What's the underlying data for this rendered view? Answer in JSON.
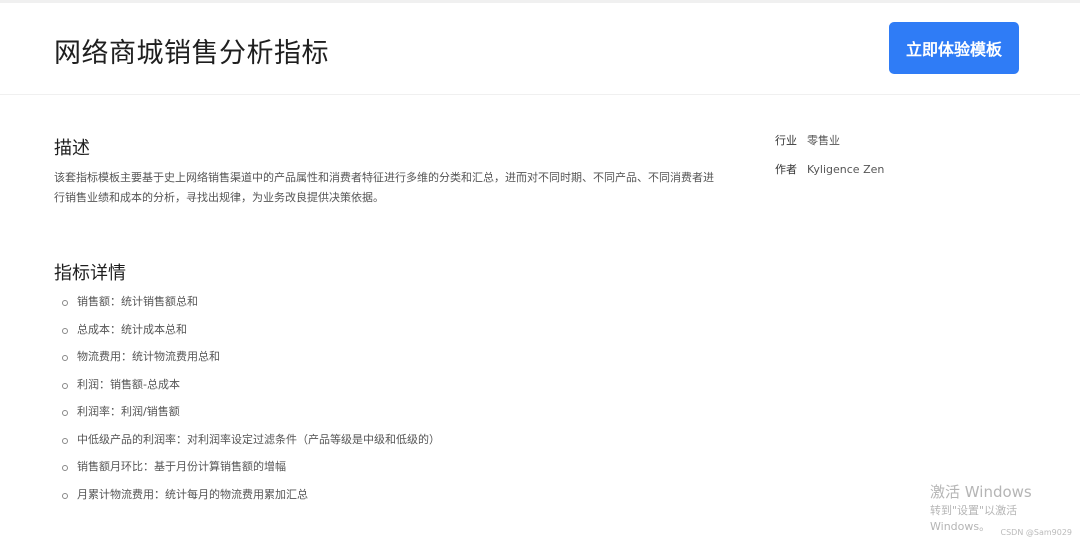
{
  "header": {
    "title": "网络商城销售分析指标",
    "cta_label": "立即体验模板"
  },
  "description": {
    "title": "描述",
    "text": "该套指标模板主要基于史上网络销售渠道中的产品属性和消费者特征进行多维的分类和汇总，进而对不同时期、不同产品、不同消费者进行销售业绩和成本的分析，寻找出规律，为业务改良提供决策依据。"
  },
  "metrics": {
    "title": "指标详情",
    "items": [
      "销售额：统计销售额总和",
      "总成本：统计成本总和",
      "物流费用：统计物流费用总和",
      "利润：销售额-总成本",
      "利润率：利润/销售额",
      "中低级产品的利润率：对利润率设定过滤条件（产品等级是中级和低级的）",
      "销售额月环比：基于月份计算销售额的增幅",
      "月累计物流费用：统计每月的物流费用累加汇总"
    ]
  },
  "meta": {
    "industry_label": "行业",
    "industry_value": "零售业",
    "author_label": "作者",
    "author_value": "Kyligence Zen"
  },
  "watermark": {
    "line1": "激活 Windows",
    "line2": "转到\"设置\"以激活 Windows。"
  },
  "credit": "CSDN @Sam9029"
}
